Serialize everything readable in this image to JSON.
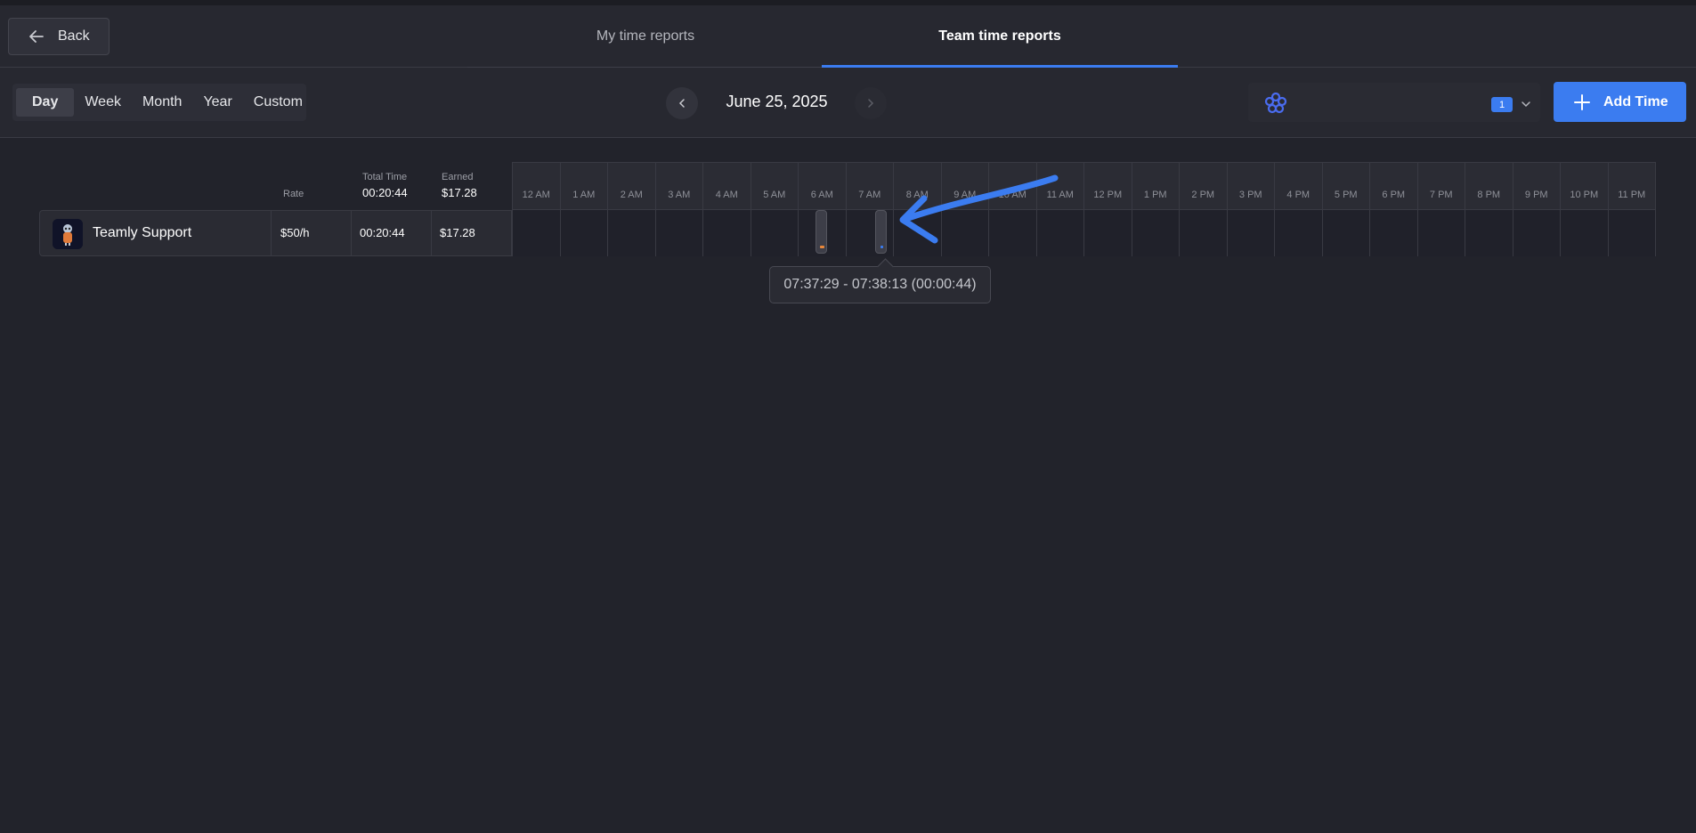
{
  "header": {
    "back_label": "Back",
    "tabs": [
      {
        "label": "My time reports",
        "active": false
      },
      {
        "label": "Team time reports",
        "active": true
      }
    ]
  },
  "toolbar": {
    "periods": [
      "Day",
      "Week",
      "Month",
      "Year",
      "Custom"
    ],
    "active_period": "Day",
    "date": "June 25, 2025",
    "team_filter_count": "1",
    "add_time_label": "Add Time",
    "accent_color": "#3b7cf0"
  },
  "table": {
    "headers": {
      "rate": "Rate",
      "total_time": "Total Time",
      "total_time_value": "00:20:44",
      "earned": "Earned",
      "earned_value": "$17.28"
    },
    "hours": [
      "12 AM",
      "1 AM",
      "2 AM",
      "3 AM",
      "4 AM",
      "5 AM",
      "6 AM",
      "7 AM",
      "8 AM",
      "9 AM",
      "10 AM",
      "11 AM",
      "12 PM",
      "1 PM",
      "2 PM",
      "3 PM",
      "4 PM",
      "5 PM",
      "6 PM",
      "7 PM",
      "8 PM",
      "9 PM",
      "10 PM",
      "11 PM"
    ],
    "rows": [
      {
        "name": "Teamly Support",
        "rate": "$50/h",
        "total_time": "00:20:44",
        "earned": "$17.28"
      }
    ]
  },
  "entries": [
    {
      "hour": "6 AM",
      "mark_color": "#e8873a"
    },
    {
      "hour": "7 AM",
      "mark_color": "#3b7cf0"
    }
  ],
  "tooltip": {
    "text": "07:37:29 - 07:38:13 (00:00:44)"
  }
}
